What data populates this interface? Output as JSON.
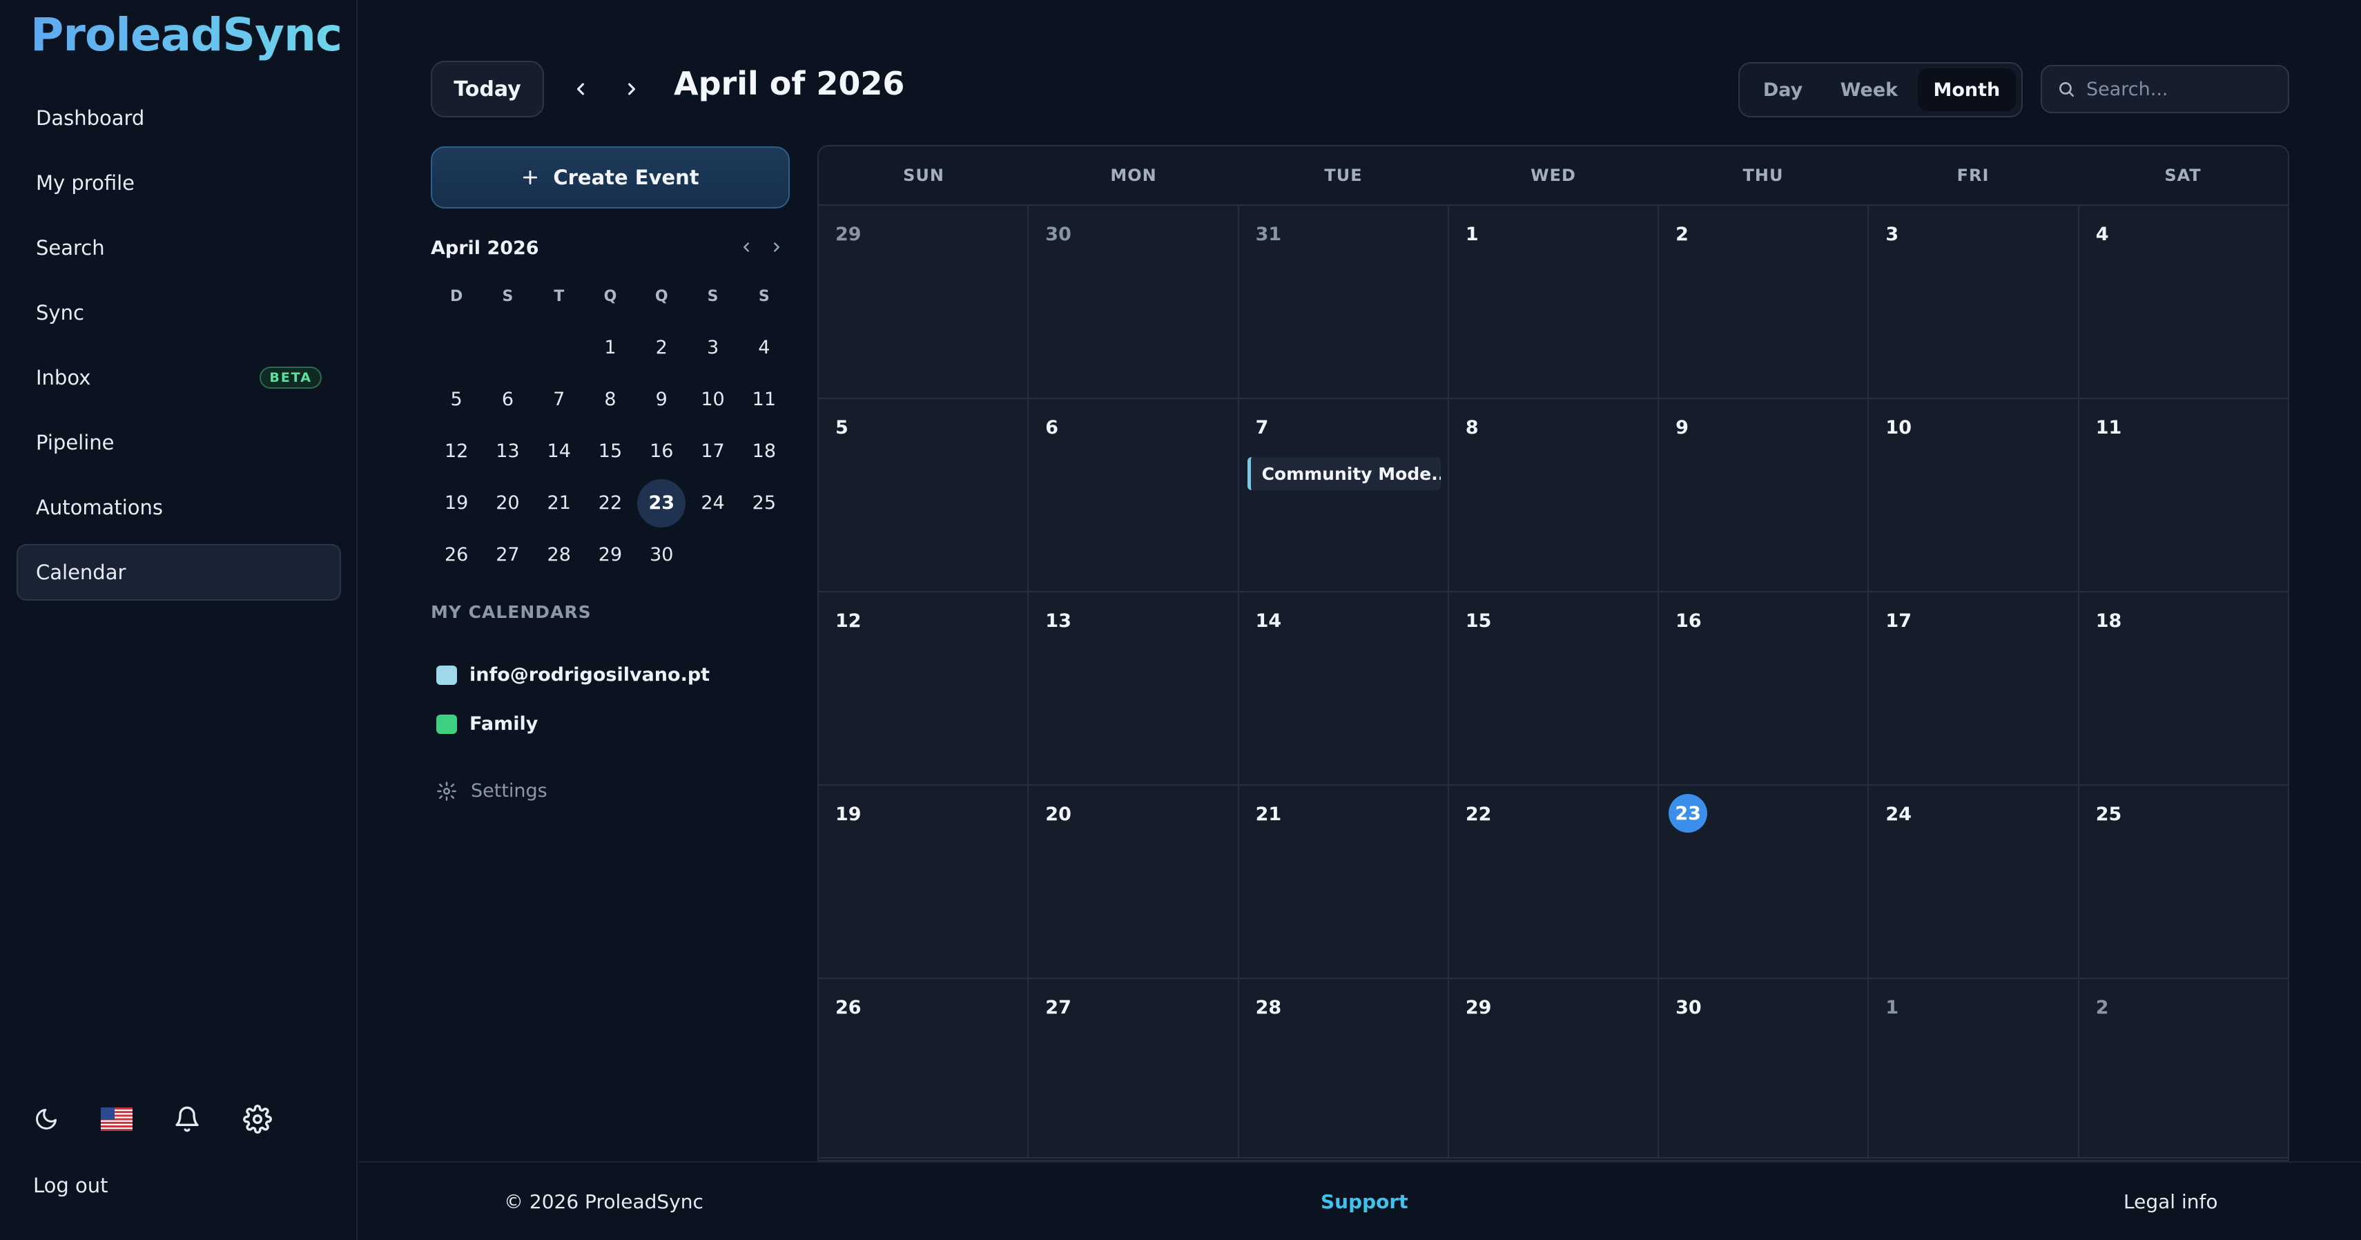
{
  "app": {
    "brand": "ProleadSync"
  },
  "sidebar": {
    "items": [
      {
        "label": "Dashboard"
      },
      {
        "label": "My profile"
      },
      {
        "label": "Search"
      },
      {
        "label": "Sync"
      },
      {
        "label": "Inbox",
        "badge": "BETA"
      },
      {
        "label": "Pipeline"
      },
      {
        "label": "Automations"
      },
      {
        "label": "Calendar",
        "active": true
      }
    ],
    "footer_icons": [
      "moon-icon",
      "us-flag-icon",
      "bell-icon",
      "gear-icon"
    ],
    "logout_label": "Log out"
  },
  "header": {
    "today_label": "Today",
    "title": "April of 2026",
    "views": [
      "Day",
      "Week",
      "Month"
    ],
    "active_view": "Month",
    "search_placeholder": "Search..."
  },
  "left_panel": {
    "create_label": "Create Event",
    "mini_calendar": {
      "title": "April 2026",
      "weekday_headers": [
        "D",
        "S",
        "T",
        "Q",
        "Q",
        "S",
        "S"
      ],
      "weeks": [
        [
          "",
          "",
          "",
          "1",
          "2",
          "3",
          "4"
        ],
        [
          "5",
          "6",
          "7",
          "8",
          "9",
          "10",
          "11"
        ],
        [
          "12",
          "13",
          "14",
          "15",
          "16",
          "17",
          "18"
        ],
        [
          "19",
          "20",
          "21",
          "22",
          "23",
          "24",
          "25"
        ],
        [
          "26",
          "27",
          "28",
          "29",
          "30",
          "",
          ""
        ]
      ],
      "selected": "23"
    },
    "calendars_title": "MY CALENDARS",
    "calendars": [
      {
        "name": "info@rodrigosilvano.pt",
        "color": "#9fd8ea"
      },
      {
        "name": "Family",
        "color": "#3fcf82"
      }
    ],
    "settings_label": "Settings"
  },
  "month_view": {
    "weekday_headers": [
      "SUN",
      "MON",
      "TUE",
      "WED",
      "THU",
      "FRI",
      "SAT"
    ],
    "weeks": [
      [
        {
          "day": "29",
          "other": true
        },
        {
          "day": "30",
          "other": true
        },
        {
          "day": "31",
          "other": true
        },
        {
          "day": "1"
        },
        {
          "day": "2"
        },
        {
          "day": "3"
        },
        {
          "day": "4"
        }
      ],
      [
        {
          "day": "5"
        },
        {
          "day": "6"
        },
        {
          "day": "7",
          "event": "Community Mode..."
        },
        {
          "day": "8"
        },
        {
          "day": "9"
        },
        {
          "day": "10"
        },
        {
          "day": "11"
        }
      ],
      [
        {
          "day": "12"
        },
        {
          "day": "13"
        },
        {
          "day": "14"
        },
        {
          "day": "15"
        },
        {
          "day": "16"
        },
        {
          "day": "17"
        },
        {
          "day": "18"
        }
      ],
      [
        {
          "day": "19"
        },
        {
          "day": "20"
        },
        {
          "day": "21"
        },
        {
          "day": "22"
        },
        {
          "day": "23",
          "today": true
        },
        {
          "day": "24"
        },
        {
          "day": "25"
        }
      ],
      [
        {
          "day": "26"
        },
        {
          "day": "27"
        },
        {
          "day": "28"
        },
        {
          "day": "29"
        },
        {
          "day": "30"
        },
        {
          "day": "1",
          "other": true
        },
        {
          "day": "2",
          "other": true
        }
      ]
    ],
    "colors": {
      "today": "#3b8eea",
      "event_accent": "#79c8e6"
    }
  },
  "footer": {
    "copyright": "© 2026 ProleadSync",
    "support": "Support",
    "legal": "Legal info"
  }
}
